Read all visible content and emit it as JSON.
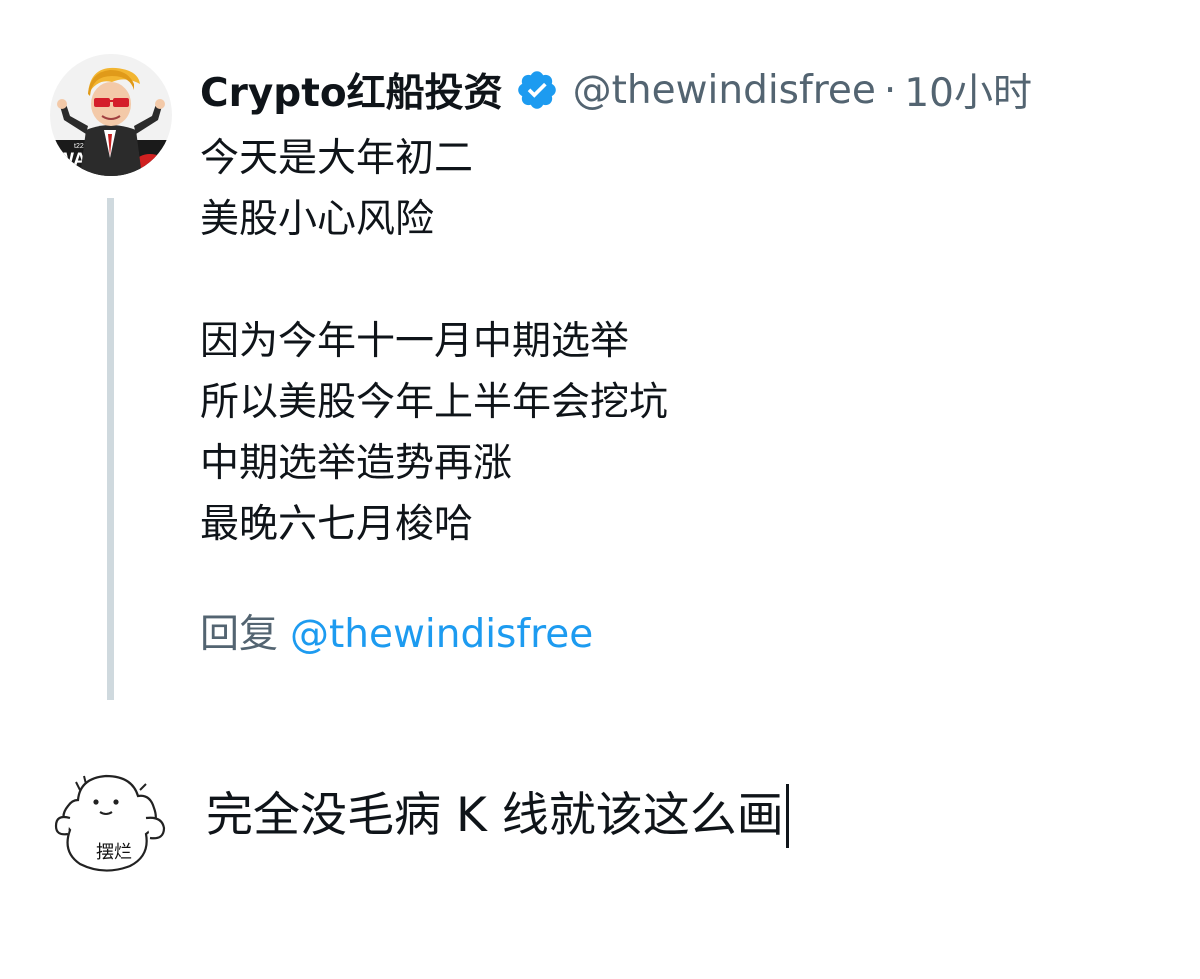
{
  "quoted_tweet": {
    "author_name": "Crypto红船投资",
    "handle": "@thewindisfree",
    "separator": "·",
    "time": "10小时",
    "avatar_label": "WALL ST",
    "avatar_sublabel": "ST",
    "avatar_small": "t22-51",
    "lines": [
      "今天是大年初二",
      "美股小心风险",
      "",
      "因为今年十一月中期选举",
      "所以美股今年上半年会挖坑",
      "中期选举造势再涨",
      "最晚六七月梭哈"
    ],
    "reply_prefix": "回复",
    "reply_mention": "@thewindisfree"
  },
  "compose": {
    "avatar_caption": "摆烂",
    "text": "完全没毛病 K 线就该这么画"
  },
  "colors": {
    "text_primary": "#0f1419",
    "text_secondary": "#536471",
    "link": "#1d9bf0",
    "thread_line": "#cfd9de",
    "verified": "#1d9bf0"
  }
}
